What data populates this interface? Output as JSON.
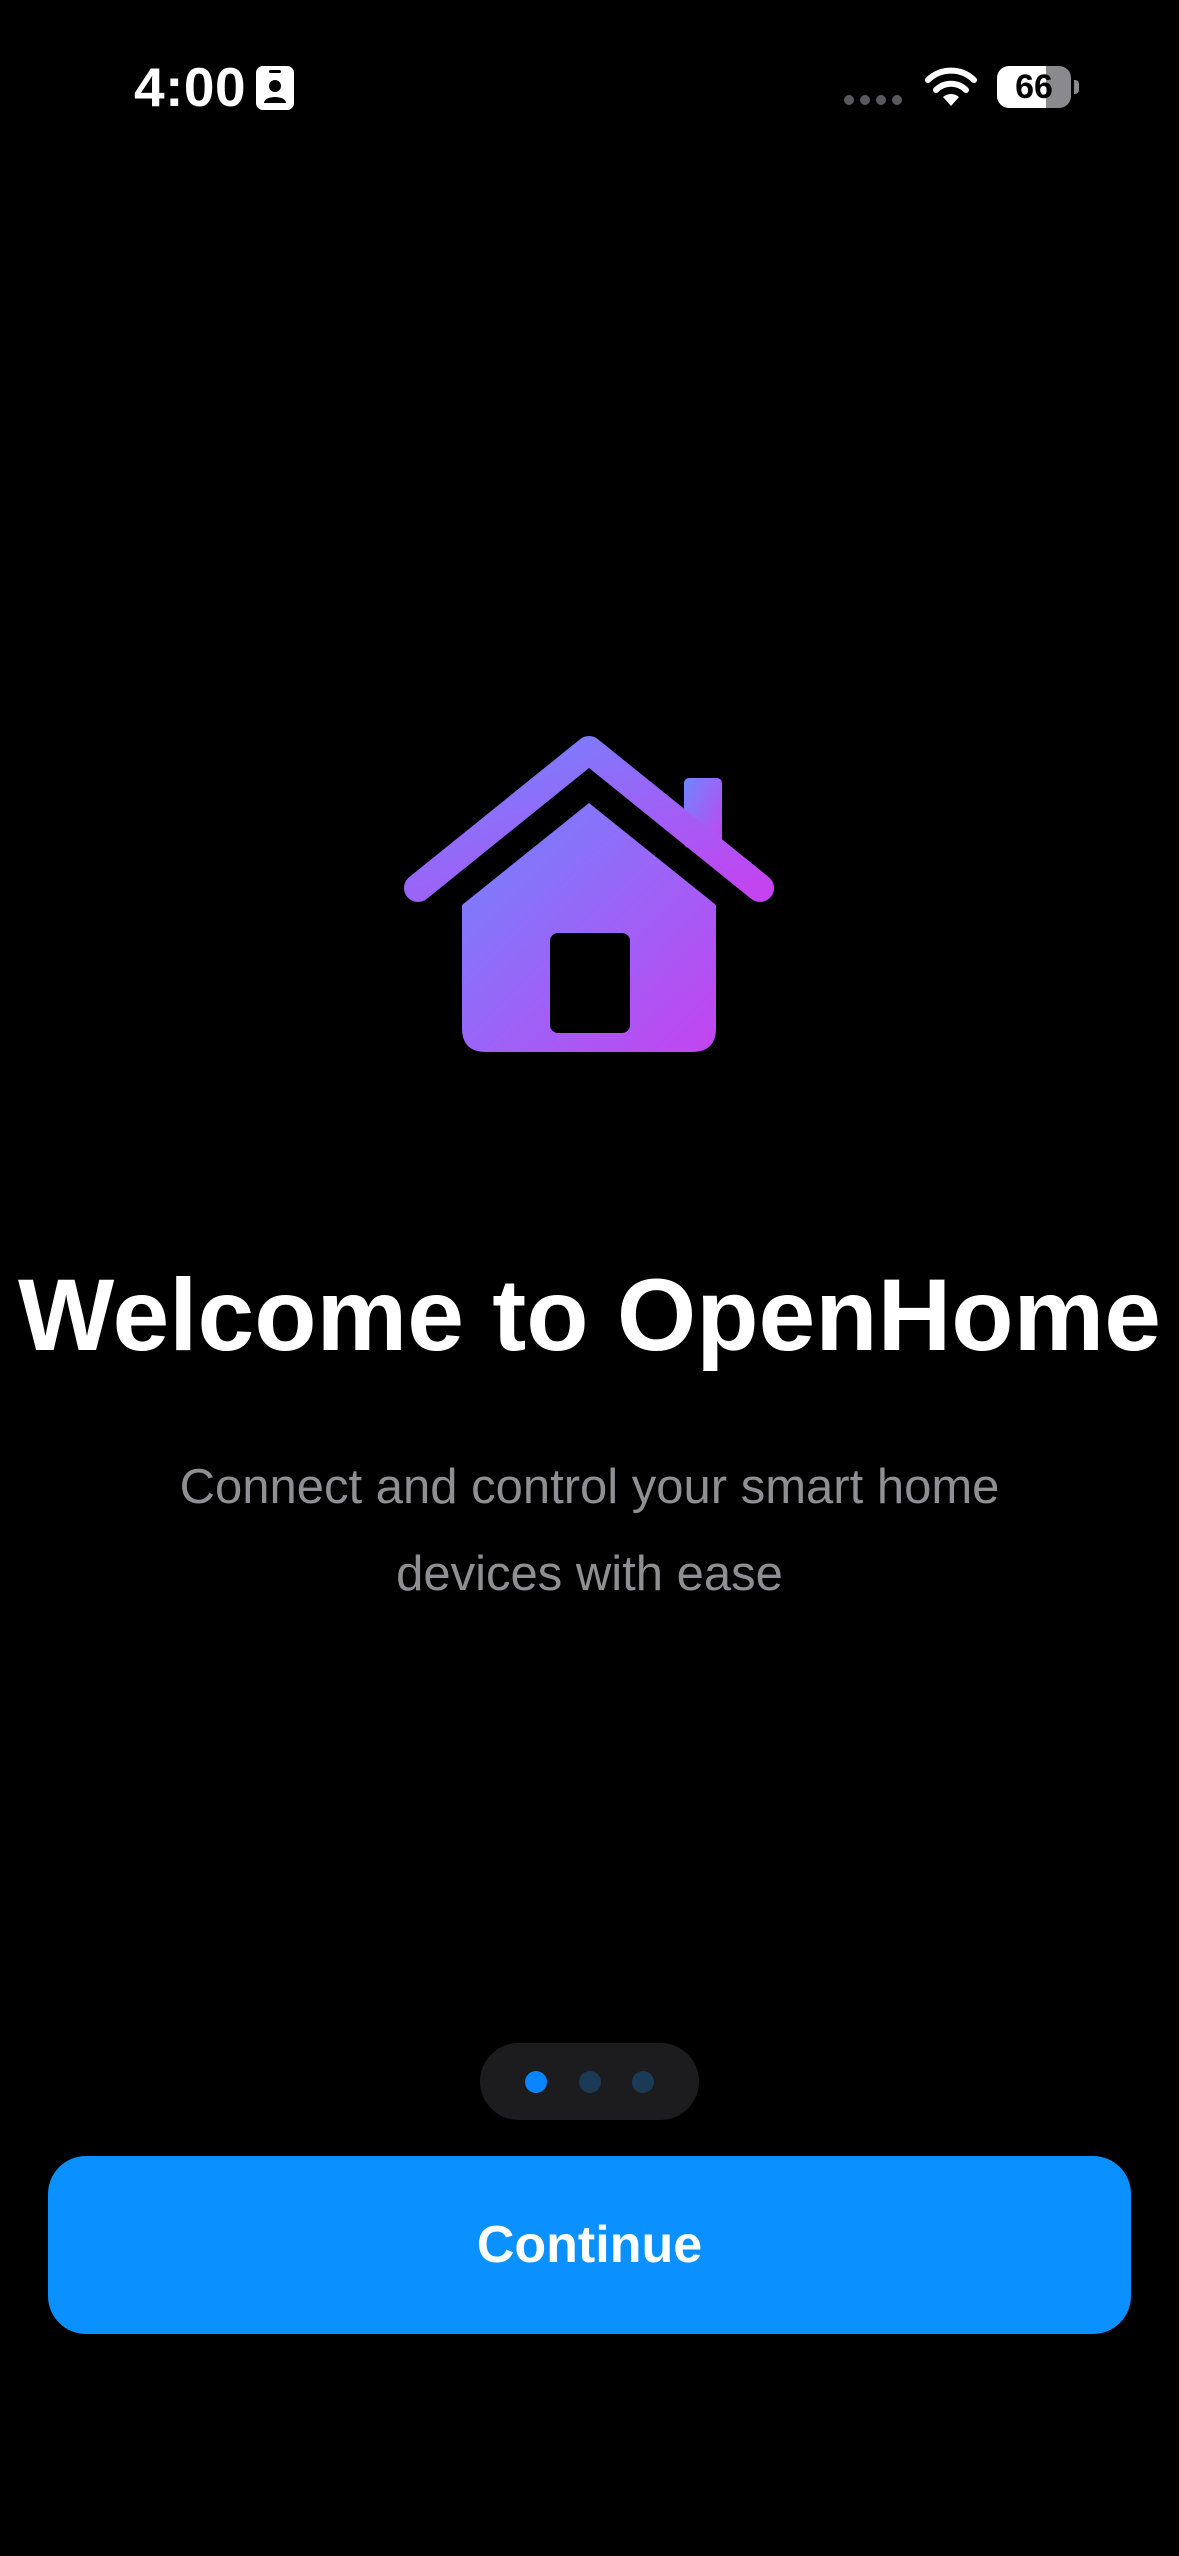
{
  "status_bar": {
    "time": "4:00",
    "battery_level": "66",
    "battery_fraction": 0.66,
    "icons": [
      "contact-card-icon",
      "cellular-signal-icon",
      "wifi-icon",
      "battery-icon"
    ]
  },
  "hero": {
    "icon": "house-icon",
    "gradient_start": "#6f86ff",
    "gradient_end": "#c344f0"
  },
  "welcome": {
    "title": "Welcome to OpenHome",
    "subtitle": "Connect and control your smart home devices with ease"
  },
  "pager": {
    "page_count": 3,
    "current_page": 1,
    "active_color": "#0a84ff",
    "inactive_color": "#1b3a55"
  },
  "actions": {
    "continue_label": "Continue",
    "continue_color": "#0a91ff"
  }
}
